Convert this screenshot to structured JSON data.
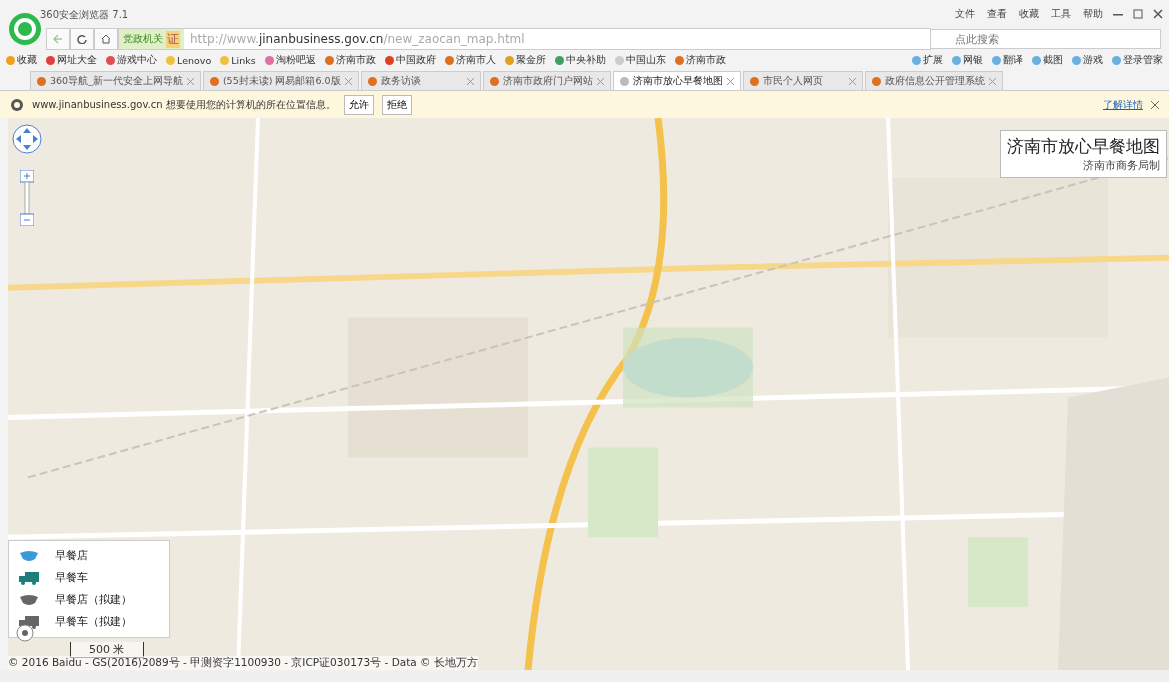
{
  "window": {
    "title": "360安全浏览器 7.1",
    "menu": [
      "文件",
      "查看",
      "收藏",
      "工具",
      "帮助"
    ]
  },
  "address_bar": {
    "badge": "党政机关",
    "badge_mark": "证",
    "url": "http://www.**jinanbusiness.gov.cn**/new_zaocan_map.html",
    "search_placeholder": "点此搜索"
  },
  "bookmarks": [
    "收藏",
    "网址大全",
    "游戏中心",
    "Lenovo",
    "Links",
    "淘粉吧返",
    "济南市政",
    "中国政府",
    "济南市人",
    "聚金所",
    "中央补助",
    "中国山东",
    "济南市政"
  ],
  "tools": [
    "扩展",
    "网银",
    "翻译",
    "截图",
    "游戏",
    "登录管家"
  ],
  "tabs": [
    {
      "label": "360导航_新一代安全上网导航",
      "selected": false
    },
    {
      "label": "(55封未读) 网易邮箱6.0版",
      "selected": false
    },
    {
      "label": "政务访谈",
      "selected": false
    },
    {
      "label": "济南市政府门户网站",
      "selected": false
    },
    {
      "label": "济南市放心早餐地图",
      "selected": true
    },
    {
      "label": "市民个人网页",
      "selected": false
    },
    {
      "label": "政府信息公开管理系统",
      "selected": false
    }
  ],
  "info_bar": {
    "message": "www.jinanbusiness.gov.cn 想要使用您的计算机的所在位置信息。",
    "buttons": [
      "允许",
      "拒绝"
    ],
    "link": "了解详情"
  },
  "map": {
    "title": "济南市放心早餐地图",
    "subtitle": "济南市商务局制",
    "legend": [
      {
        "kind": "shop",
        "proposed": false,
        "label": "早餐店"
      },
      {
        "kind": "truck",
        "proposed": false,
        "label": "早餐车"
      },
      {
        "kind": "shop",
        "proposed": true,
        "label": "早餐店（拟建）"
      },
      {
        "kind": "truck",
        "proposed": true,
        "label": "早餐车（拟建）"
      }
    ],
    "scale": "500 米",
    "copyright": "© 2016 Baidu - GS(2016)2089号 - 甲测资字1100930 - 京ICP证030173号 - Data © 长地万方"
  }
}
